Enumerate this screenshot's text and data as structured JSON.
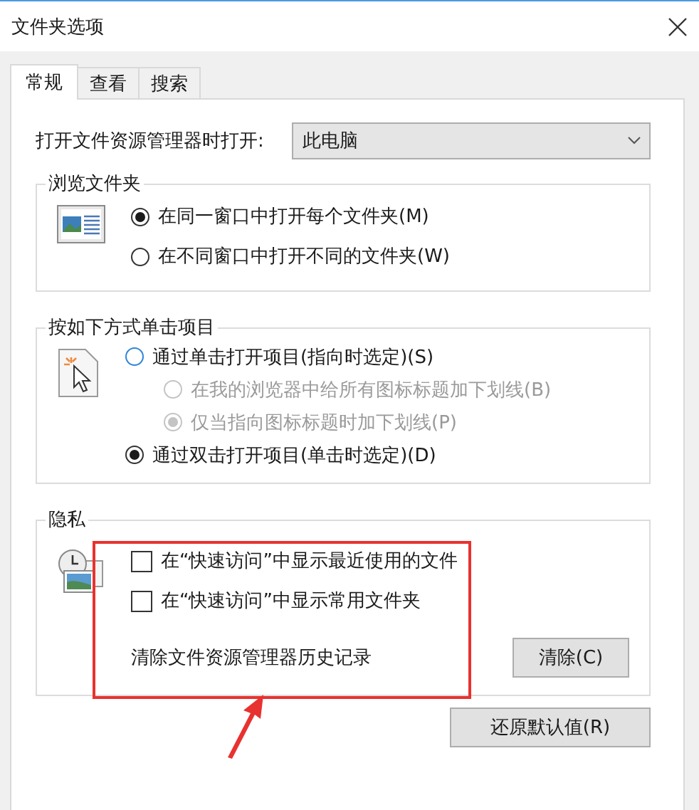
{
  "window": {
    "title": "文件夹选项"
  },
  "tabs": [
    {
      "label": "常规",
      "selected": true
    },
    {
      "label": "查看",
      "selected": false
    },
    {
      "label": "搜索",
      "selected": false
    }
  ],
  "open_explorer": {
    "label": "打开文件资源管理器时打开:",
    "value": "此电脑"
  },
  "browse_folders": {
    "title": "浏览文件夹",
    "options": [
      {
        "label": "在同一窗口中打开每个文件夹(M)",
        "selected": true,
        "disabled": false
      },
      {
        "label": "在不同窗口中打开不同的文件夹(W)",
        "selected": false,
        "disabled": false
      }
    ]
  },
  "click_items": {
    "title": "按如下方式单击项目",
    "options": [
      {
        "label": "通过单击打开项目(指向时选定)(S)",
        "selected": false,
        "disabled": false,
        "children": [
          {
            "label": "在我的浏览器中给所有图标标题加下划线(B)",
            "selected": false,
            "disabled": true
          },
          {
            "label": "仅当指向图标标题时加下划线(P)",
            "selected": true,
            "disabled": true
          }
        ]
      },
      {
        "label": "通过双击打开项目(单击时选定)(D)",
        "selected": true,
        "disabled": false
      }
    ]
  },
  "privacy": {
    "title": "隐私",
    "checkboxes": [
      {
        "label": "在“快速访问”中显示最近使用的文件",
        "checked": false
      },
      {
        "label": "在“快速访问”中显示常用文件夹",
        "checked": false
      }
    ],
    "clear_label": "清除文件资源管理器历史记录",
    "clear_button": "清除(C)"
  },
  "restore_button": "还原默认值(R)"
}
